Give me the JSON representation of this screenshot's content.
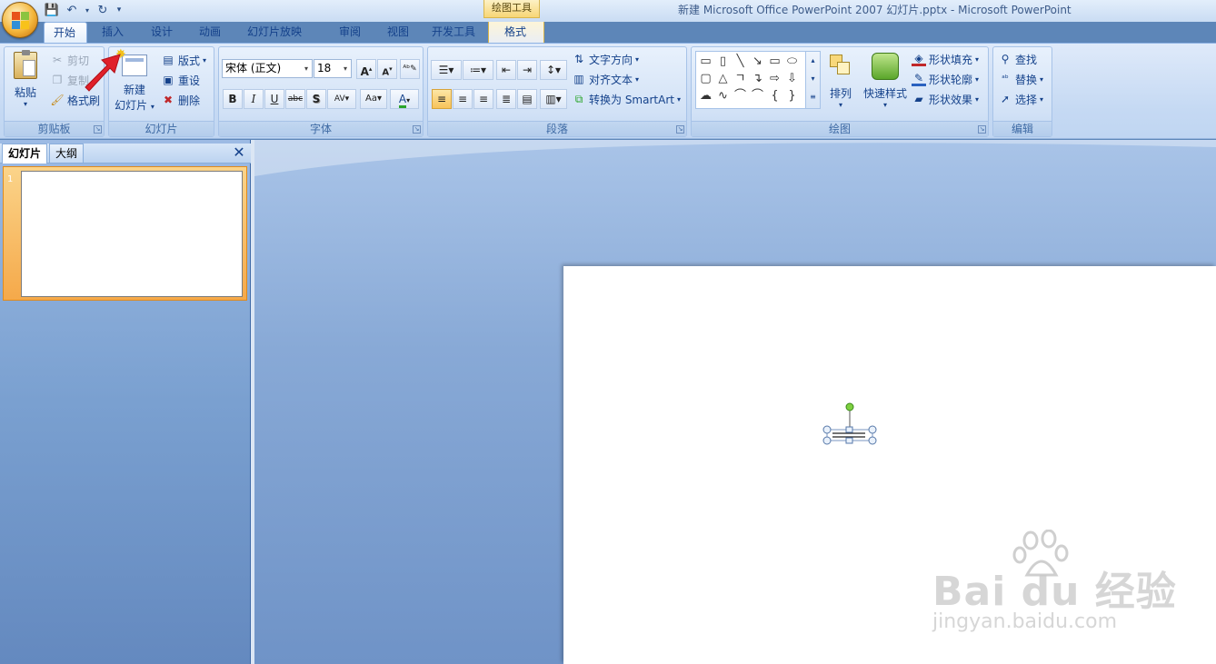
{
  "window": {
    "title": "新建 Microsoft Office PowerPoint 2007 幻灯片.pptx - Microsoft PowerPoint"
  },
  "context_tab_header": "绘图工具",
  "tabs": [
    {
      "label": "开始",
      "active": true
    },
    {
      "label": "插入"
    },
    {
      "label": "设计"
    },
    {
      "label": "动画"
    },
    {
      "label": "幻灯片放映"
    },
    {
      "label": "审阅"
    },
    {
      "label": "视图"
    },
    {
      "label": "开发工具"
    },
    {
      "label": "格式",
      "contextual": true
    }
  ],
  "ribbon": {
    "clipboard": {
      "label": "剪贴板",
      "paste": "粘贴",
      "cut": "剪切",
      "copy": "复制",
      "format_painter": "格式刷"
    },
    "slides": {
      "label": "幻灯片",
      "new_slide_line1": "新建",
      "new_slide_line2": "幻灯片",
      "layout": "版式",
      "reset": "重设",
      "delete": "删除"
    },
    "font": {
      "label": "字体",
      "font_name": "宋体 (正文)",
      "font_size": "18"
    },
    "paragraph": {
      "label": "段落",
      "text_direction": "文字方向",
      "align_text": "对齐文本",
      "smartart": "转换为 SmartArt"
    },
    "drawing": {
      "label": "绘图",
      "arrange": "排列",
      "quick_styles": "快速样式",
      "shape_fill": "形状填充",
      "shape_outline": "形状轮廓",
      "shape_effects": "形状效果"
    },
    "editing": {
      "label": "编辑",
      "find": "查找",
      "replace": "替换",
      "select": "选择"
    }
  },
  "side_panel": {
    "tab_slides": "幻灯片",
    "tab_outline": "大纲",
    "slide_number": "1"
  },
  "watermark": {
    "brand": "Bai du 经验",
    "url": "jingyan.baidu.com"
  },
  "colors": {
    "accent": "#15428b",
    "ribbon_bg": "#c5d9f3",
    "selection": "#f5a94a",
    "arrow": "#e0202a"
  }
}
